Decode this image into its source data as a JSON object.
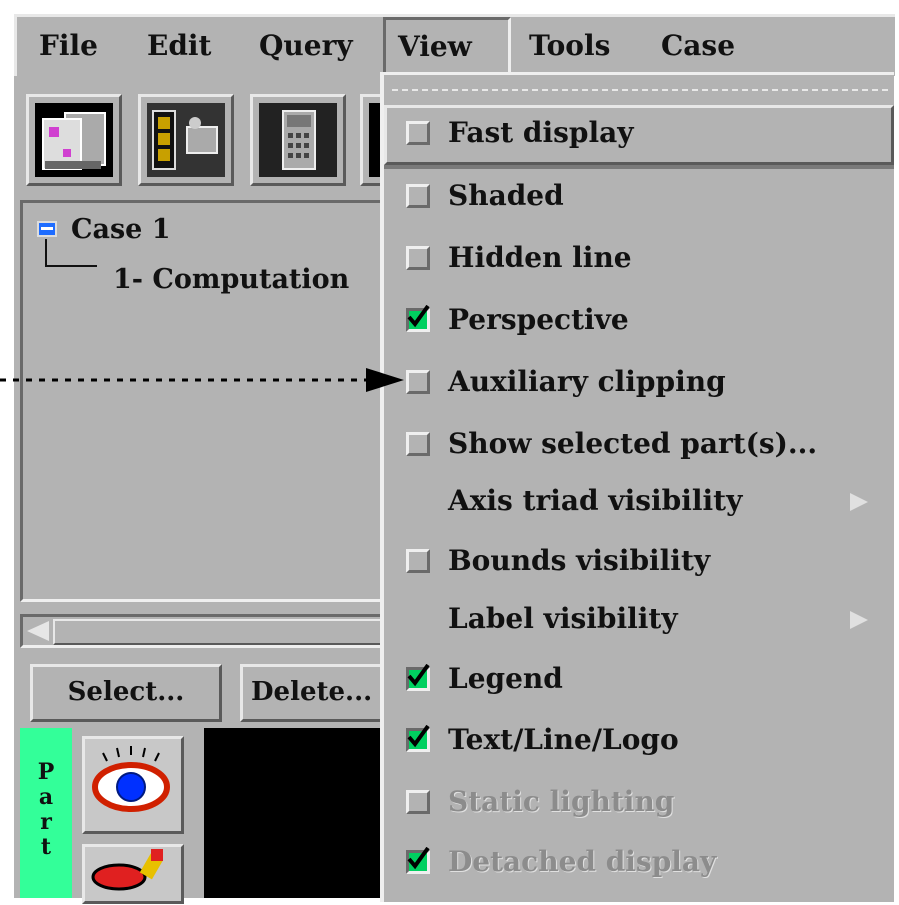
{
  "menubar": {
    "items": [
      "File",
      "Edit",
      "Query",
      "View",
      "Tools",
      "Case"
    ]
  },
  "tree": {
    "case_label": "Case 1",
    "child_label": "1- Computation"
  },
  "part_buttons": {
    "select": "Select...",
    "delete": "Delete..."
  },
  "parts_strip": [
    "P",
    "a",
    "r",
    "t"
  ],
  "view_menu": {
    "items": [
      {
        "label": "Fast display",
        "checkbox": true,
        "checked": false,
        "enabled": true,
        "submenu": false
      },
      {
        "label": "Shaded",
        "checkbox": true,
        "checked": false,
        "enabled": true,
        "submenu": false
      },
      {
        "label": "Hidden line",
        "checkbox": true,
        "checked": false,
        "enabled": true,
        "submenu": false
      },
      {
        "label": "Perspective",
        "checkbox": true,
        "checked": true,
        "enabled": true,
        "submenu": false
      },
      {
        "label": "Auxiliary clipping",
        "checkbox": true,
        "checked": false,
        "enabled": true,
        "submenu": false
      },
      {
        "label": "Show selected part(s)...",
        "checkbox": true,
        "checked": false,
        "enabled": true,
        "submenu": false
      },
      {
        "label": "Axis triad visibility",
        "checkbox": false,
        "checked": false,
        "enabled": true,
        "submenu": true
      },
      {
        "label": "Bounds visibility",
        "checkbox": true,
        "checked": false,
        "enabled": true,
        "submenu": false
      },
      {
        "label": "Label visibility",
        "checkbox": false,
        "checked": false,
        "enabled": true,
        "submenu": true
      },
      {
        "label": "Legend",
        "checkbox": true,
        "checked": true,
        "enabled": true,
        "submenu": false
      },
      {
        "label": "Text/Line/Logo",
        "checkbox": true,
        "checked": true,
        "enabled": true,
        "submenu": false
      },
      {
        "label": "Static lighting",
        "checkbox": true,
        "checked": false,
        "enabled": false,
        "submenu": false
      },
      {
        "label": "Detached display",
        "checkbox": true,
        "checked": true,
        "enabled": false,
        "submenu": false
      }
    ]
  },
  "colors": {
    "panel": "#b3b3b3",
    "check": "#00d060",
    "parts_strip": "#33ff99"
  }
}
